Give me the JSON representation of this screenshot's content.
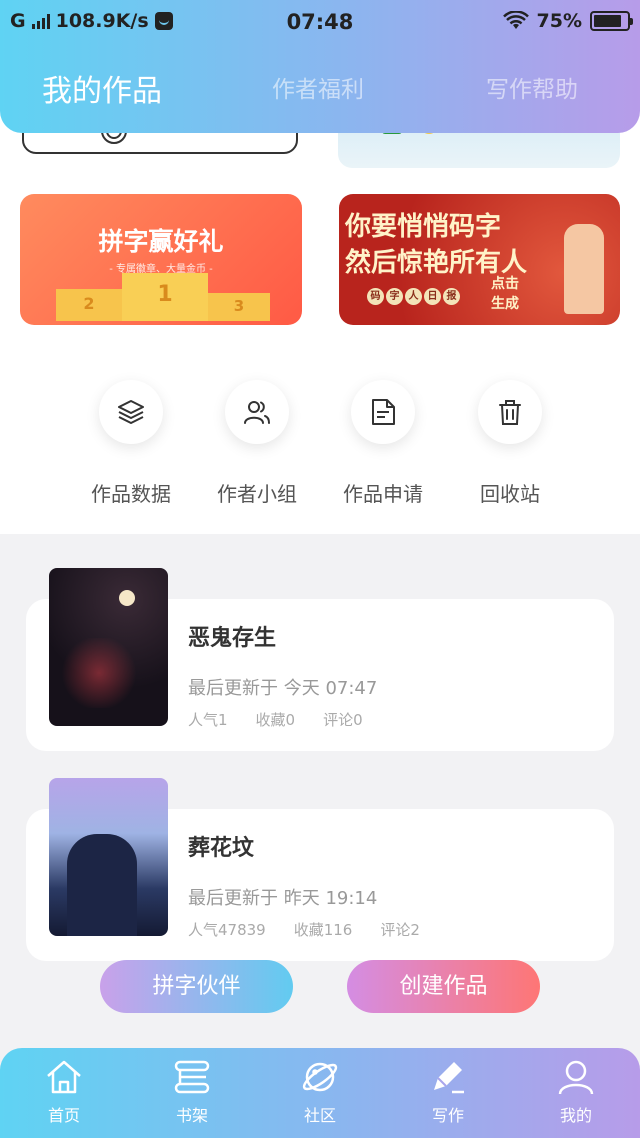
{
  "status_bar": {
    "carrier": "G",
    "speed": "108.9K/s",
    "time": "07:48",
    "battery": "75%",
    "battery_level": 0.75
  },
  "header": {
    "tabs": [
      {
        "label": "我的作品",
        "active": true
      },
      {
        "label": "作者福利",
        "active": false
      },
      {
        "label": "写作帮助",
        "active": false
      }
    ]
  },
  "banners": {
    "contest": {
      "title": "拼字赢好礼",
      "subtitle": "- 专属徽章、大量金币 -",
      "podium": [
        "2",
        "1",
        "3"
      ]
    },
    "report": {
      "line1": "你要悄悄码字",
      "line2": "然后惊艳所有人",
      "tags": [
        "码",
        "字",
        "人",
        "日",
        "报"
      ],
      "cta": "点击生成"
    }
  },
  "quick_actions": [
    {
      "label": "作品数据",
      "icon": "layers-icon"
    },
    {
      "label": "作者小组",
      "icon": "group-icon"
    },
    {
      "label": "作品申请",
      "icon": "document-icon"
    },
    {
      "label": "回收站",
      "icon": "trash-icon"
    }
  ],
  "works": [
    {
      "title": "恶鬼存生",
      "updated": "最后更新于 今天 07:47",
      "popularity": "人气1",
      "favorites": "收藏0",
      "comments": "评论0"
    },
    {
      "title": "葬花坟",
      "updated": "最后更新于 昨天 19:14",
      "popularity": "人气47839",
      "favorites": "收藏116",
      "comments": "评论2"
    }
  ],
  "actions": {
    "partner": "拼字伙伴",
    "create": "创建作品"
  },
  "bottom_nav": [
    {
      "label": "首页",
      "icon": "home-icon"
    },
    {
      "label": "书架",
      "icon": "bookshelf-icon"
    },
    {
      "label": "社区",
      "icon": "planet-icon"
    },
    {
      "label": "写作",
      "icon": "write-icon"
    },
    {
      "label": "我的",
      "icon": "profile-icon"
    }
  ],
  "colors": {
    "gradient_start": "#5fd3f3",
    "gradient_end": "#b79ce9",
    "create_button": "#fe7675"
  }
}
